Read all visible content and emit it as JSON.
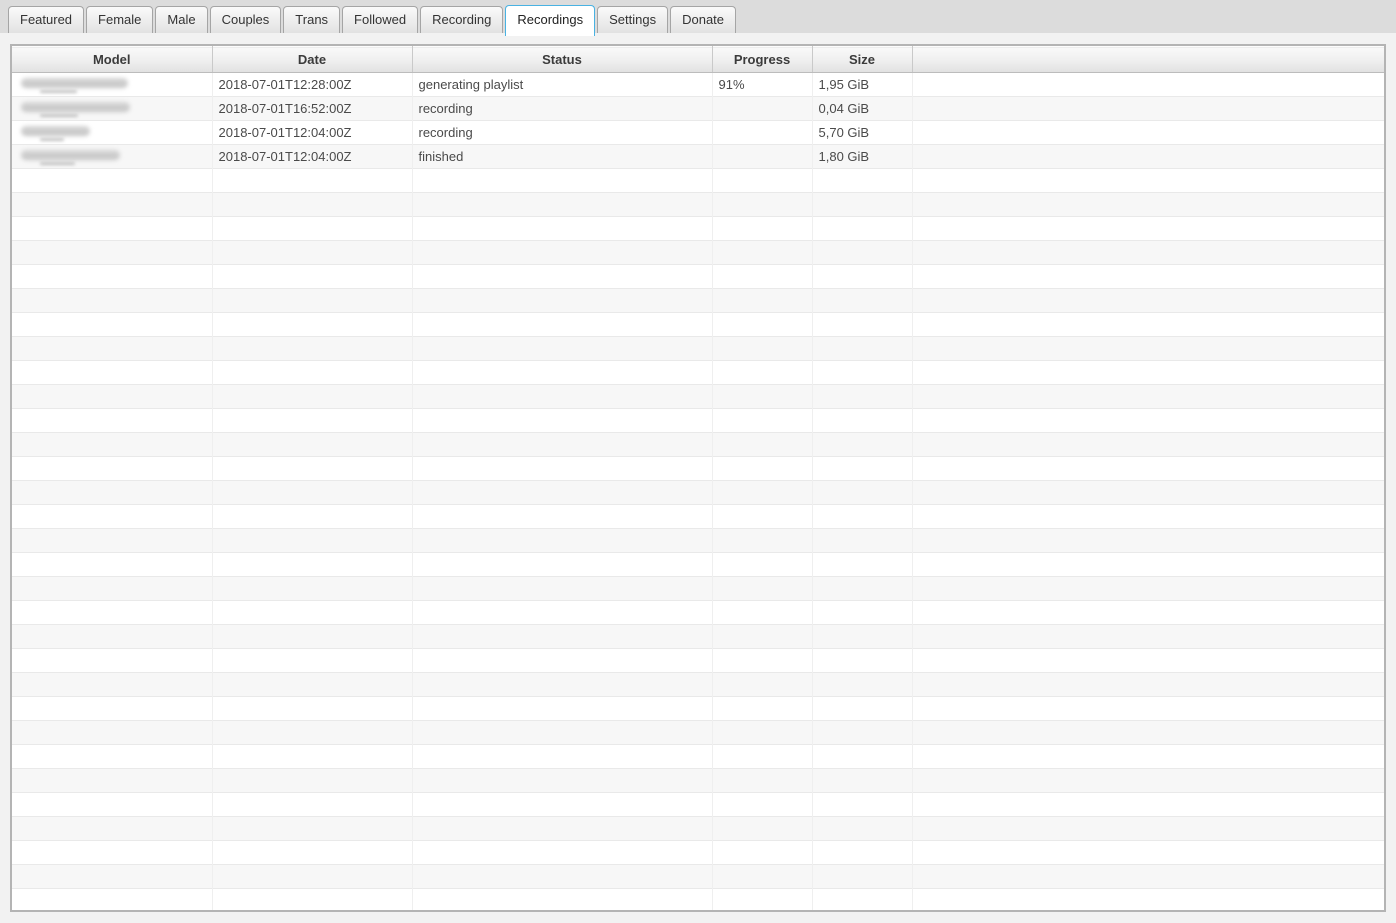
{
  "tabs": {
    "items": [
      {
        "id": "featured",
        "label": "Featured",
        "active": false
      },
      {
        "id": "female",
        "label": "Female",
        "active": false
      },
      {
        "id": "male",
        "label": "Male",
        "active": false
      },
      {
        "id": "couples",
        "label": "Couples",
        "active": false
      },
      {
        "id": "trans",
        "label": "Trans",
        "active": false
      },
      {
        "id": "followed",
        "label": "Followed",
        "active": false
      },
      {
        "id": "recording",
        "label": "Recording",
        "active": false
      },
      {
        "id": "recordings",
        "label": "Recordings",
        "active": true
      },
      {
        "id": "settings",
        "label": "Settings",
        "active": false
      },
      {
        "id": "donate",
        "label": "Donate",
        "active": false
      }
    ]
  },
  "table": {
    "columns": [
      {
        "id": "model",
        "label": "Model"
      },
      {
        "id": "date",
        "label": "Date"
      },
      {
        "id": "status",
        "label": "Status"
      },
      {
        "id": "progress",
        "label": "Progress"
      },
      {
        "id": "size",
        "label": "Size"
      },
      {
        "id": "spacer",
        "label": ""
      }
    ],
    "rows": [
      {
        "model_blurred": true,
        "blur_width": 107,
        "date": "2018-07-01T12:28:00Z",
        "status": "generating playlist",
        "progress": "91%",
        "size": "1,95 GiB"
      },
      {
        "model_blurred": true,
        "blur_width": 109,
        "date": "2018-07-01T16:52:00Z",
        "status": "recording",
        "progress": "",
        "size": "0,04 GiB"
      },
      {
        "model_blurred": true,
        "blur_width": 69,
        "date": "2018-07-01T12:04:00Z",
        "status": "recording",
        "progress": "",
        "size": "5,70 GiB"
      },
      {
        "model_blurred": true,
        "blur_width": 99,
        "date": "2018-07-01T12:04:00Z",
        "status": "finished",
        "progress": "",
        "size": "1,80 GiB"
      }
    ],
    "empty_row_count": 31
  },
  "colors": {
    "accent": "#49b2e2",
    "tab_bar_bg": "#dcdcdc",
    "content_bg": "#f2f2f2",
    "row_stripe": "#f7f7f7",
    "table_border": "#b4b4b4"
  }
}
